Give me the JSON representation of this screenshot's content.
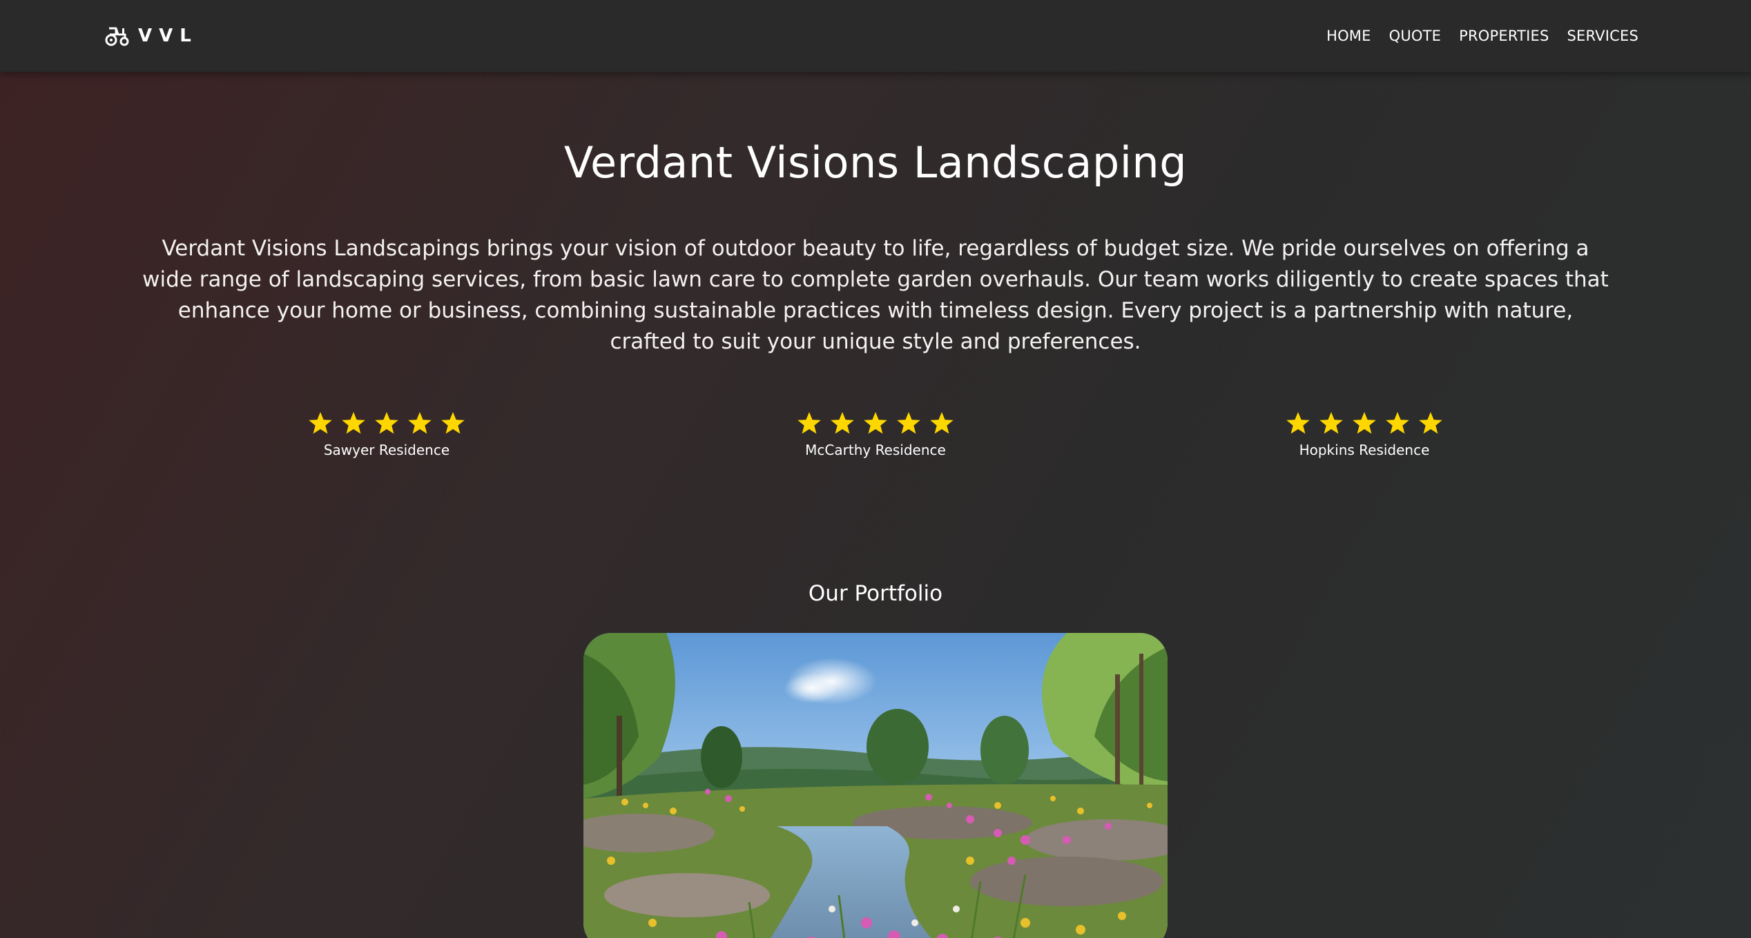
{
  "navbar": {
    "brand_icon": "tractor-icon",
    "brand_text": "VVL",
    "links": [
      "HOME",
      "QUOTE",
      "PROPERTIES",
      "SERVICES"
    ]
  },
  "hero": {
    "title": "Verdant Visions Landscaping",
    "description": "Verdant Visions Landscapings brings your vision of outdoor beauty to life, regardless of budget size. We pride ourselves on offering a wide range of landscaping services, from basic lawn care to complete garden overhauls. Our team works diligently to create spaces that enhance your home or business, combining sustainable practices with timeless design. Every project is a partnership with nature, crafted to suit your unique style and preferences."
  },
  "reviews": [
    {
      "name": "Sawyer Residence",
      "rating": 5,
      "max_rating": 5
    },
    {
      "name": "McCarthy Residence",
      "rating": 5,
      "max_rating": 5
    },
    {
      "name": "Hopkins Residence",
      "rating": 5,
      "max_rating": 5
    }
  ],
  "portfolio": {
    "title": "Our Portfolio",
    "image_subject": "wildflower-meadow-with-stream"
  },
  "colors": {
    "navbar_bg": "#2a2a2a",
    "star": "#ffd700",
    "text": "#ffffff",
    "bg_left": "#3e2223",
    "bg_right": "#2c3030"
  }
}
